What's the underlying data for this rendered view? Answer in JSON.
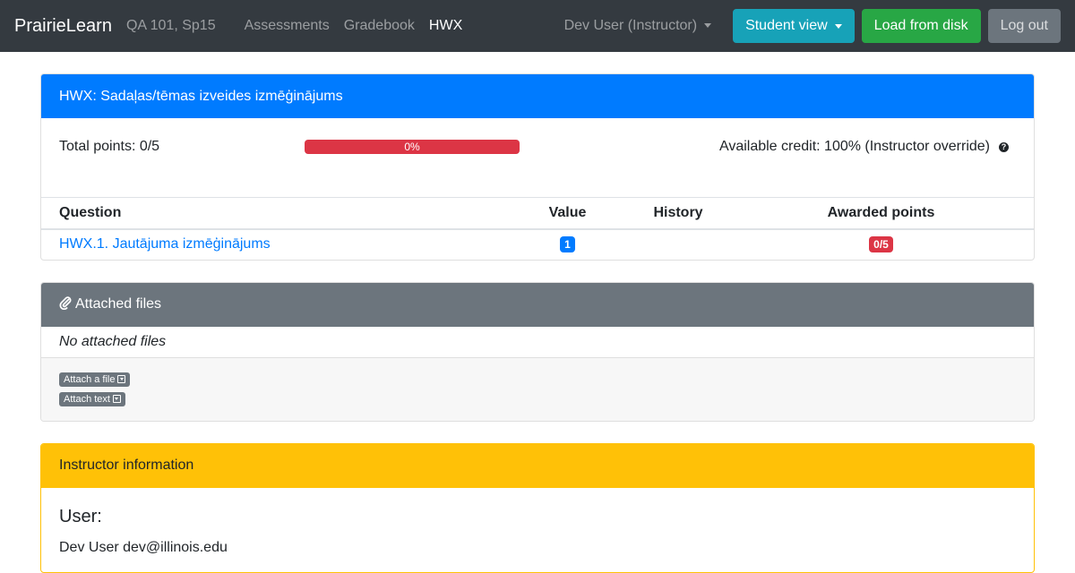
{
  "navbar": {
    "brand": "PrairieLearn",
    "course": "QA 101, Sp15",
    "links": [
      "Assessments",
      "Gradebook",
      "HWX"
    ],
    "user_menu": "Dev User (Instructor)",
    "student_view": "Student view",
    "load_from_disk": "Load from disk",
    "logout": "Log out"
  },
  "assessment": {
    "title": "HWX: Sadaļas/tēmas izveides izmēģinājums",
    "total_points": "Total points: 0/5",
    "progress_label": "0%",
    "progress_fraction": 0,
    "available_credit": "Available credit: 100% (Instructor override)"
  },
  "table": {
    "headers": [
      "Question",
      "Value",
      "History",
      "Awarded points"
    ],
    "rows": [
      {
        "question": "HWX.1. Jautājuma izmēģinājums",
        "value": "1",
        "history": "",
        "awarded": "0/5"
      }
    ]
  },
  "attached_files": {
    "title": "Attached files",
    "empty_text": "No attached files",
    "attach_file": "Attach a file",
    "attach_text": "Attach text"
  },
  "instructor_info": {
    "title": "Instructor information",
    "user_heading": "User:",
    "user_line": "Dev User dev@illinois.edu"
  },
  "colors": {
    "navbar": "#343a40",
    "primary": "#007bff",
    "info": "#17a2b8",
    "success": "#28a745",
    "secondary": "#6c757d",
    "warning": "#ffc107",
    "danger": "#dc3545"
  }
}
